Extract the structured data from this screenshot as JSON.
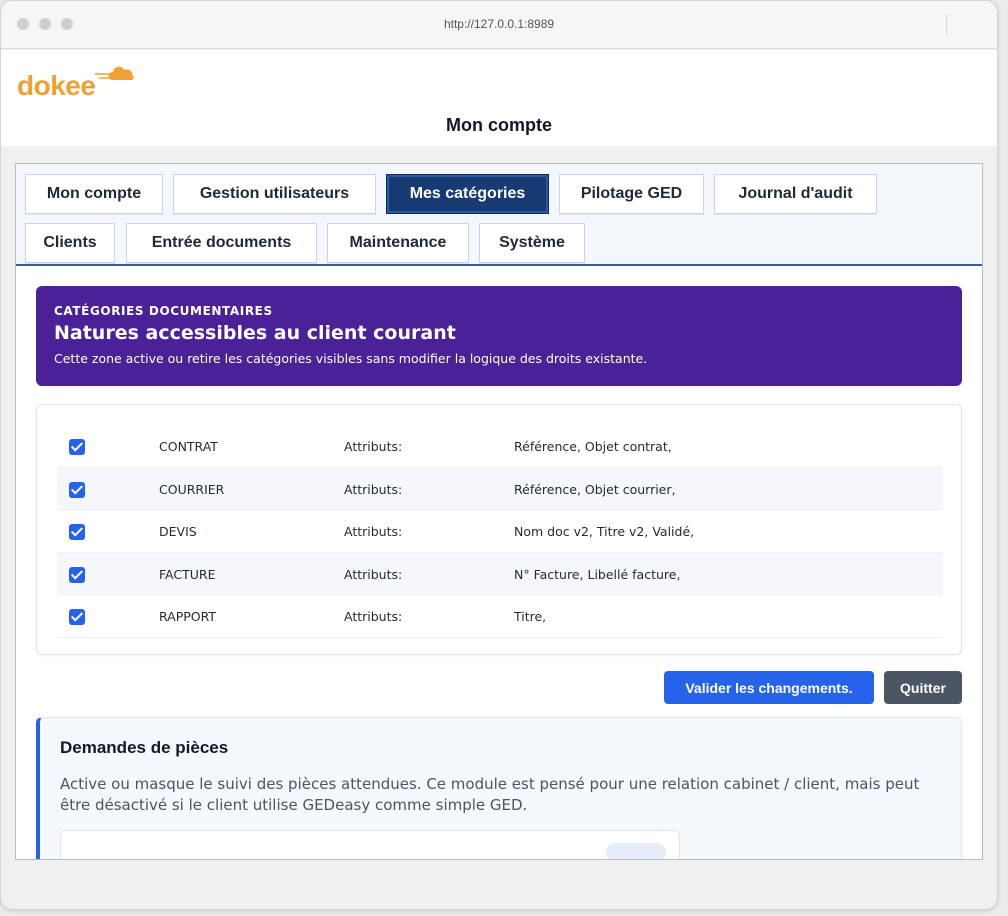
{
  "browser": {
    "url": "http://127.0.0.1:8989"
  },
  "header": {
    "logo_text": "dokee",
    "page_title": "Mon compte"
  },
  "tabs": [
    {
      "label": "Mon compte"
    },
    {
      "label": "Gestion utilisateurs"
    },
    {
      "label": "Mes catégories",
      "active": true
    },
    {
      "label": "Pilotage GED"
    },
    {
      "label": "Journal d'audit"
    },
    {
      "label": "Clients"
    },
    {
      "label": "Entrée documents"
    },
    {
      "label": "Maintenance"
    },
    {
      "label": "Système"
    }
  ],
  "banner": {
    "kicker": "CATÉGORIES DOCUMENTAIRES",
    "title": "Natures accessibles au client courant",
    "description": "Cette zone active ou retire les catégories visibles sans modifier la logique des droits existante."
  },
  "categories": [
    {
      "checked": true,
      "name": "CONTRAT",
      "attr_label": "Attributs:",
      "attributes": "Référence, Objet contrat,"
    },
    {
      "checked": true,
      "name": "COURRIER",
      "attr_label": "Attributs:",
      "attributes": "Référence, Objet courrier,"
    },
    {
      "checked": true,
      "name": "DEVIS",
      "attr_label": "Attributs:",
      "attributes": "Nom doc v2, Titre v2, Validé,"
    },
    {
      "checked": true,
      "name": "FACTURE",
      "attr_label": "Attributs:",
      "attributes": "N° Facture, Libellé facture,"
    },
    {
      "checked": true,
      "name": "RAPPORT",
      "attr_label": "Attributs:",
      "attributes": "Titre,"
    }
  ],
  "actions": {
    "validate_label": "Valider les changements.",
    "quit_label": "Quitter"
  },
  "demandes": {
    "title": "Demandes de pièces",
    "description": "Active ou masque le suivi des pièces attendues. Ce module est pensé pour une relation cabinet / client, mais peut être désactivé si le client utilise GEDeasy comme simple GED."
  },
  "colors": {
    "accent": "#2563eb",
    "banner": "#4a2196",
    "active_tab": "#173a72",
    "logo": "#f0a034"
  }
}
